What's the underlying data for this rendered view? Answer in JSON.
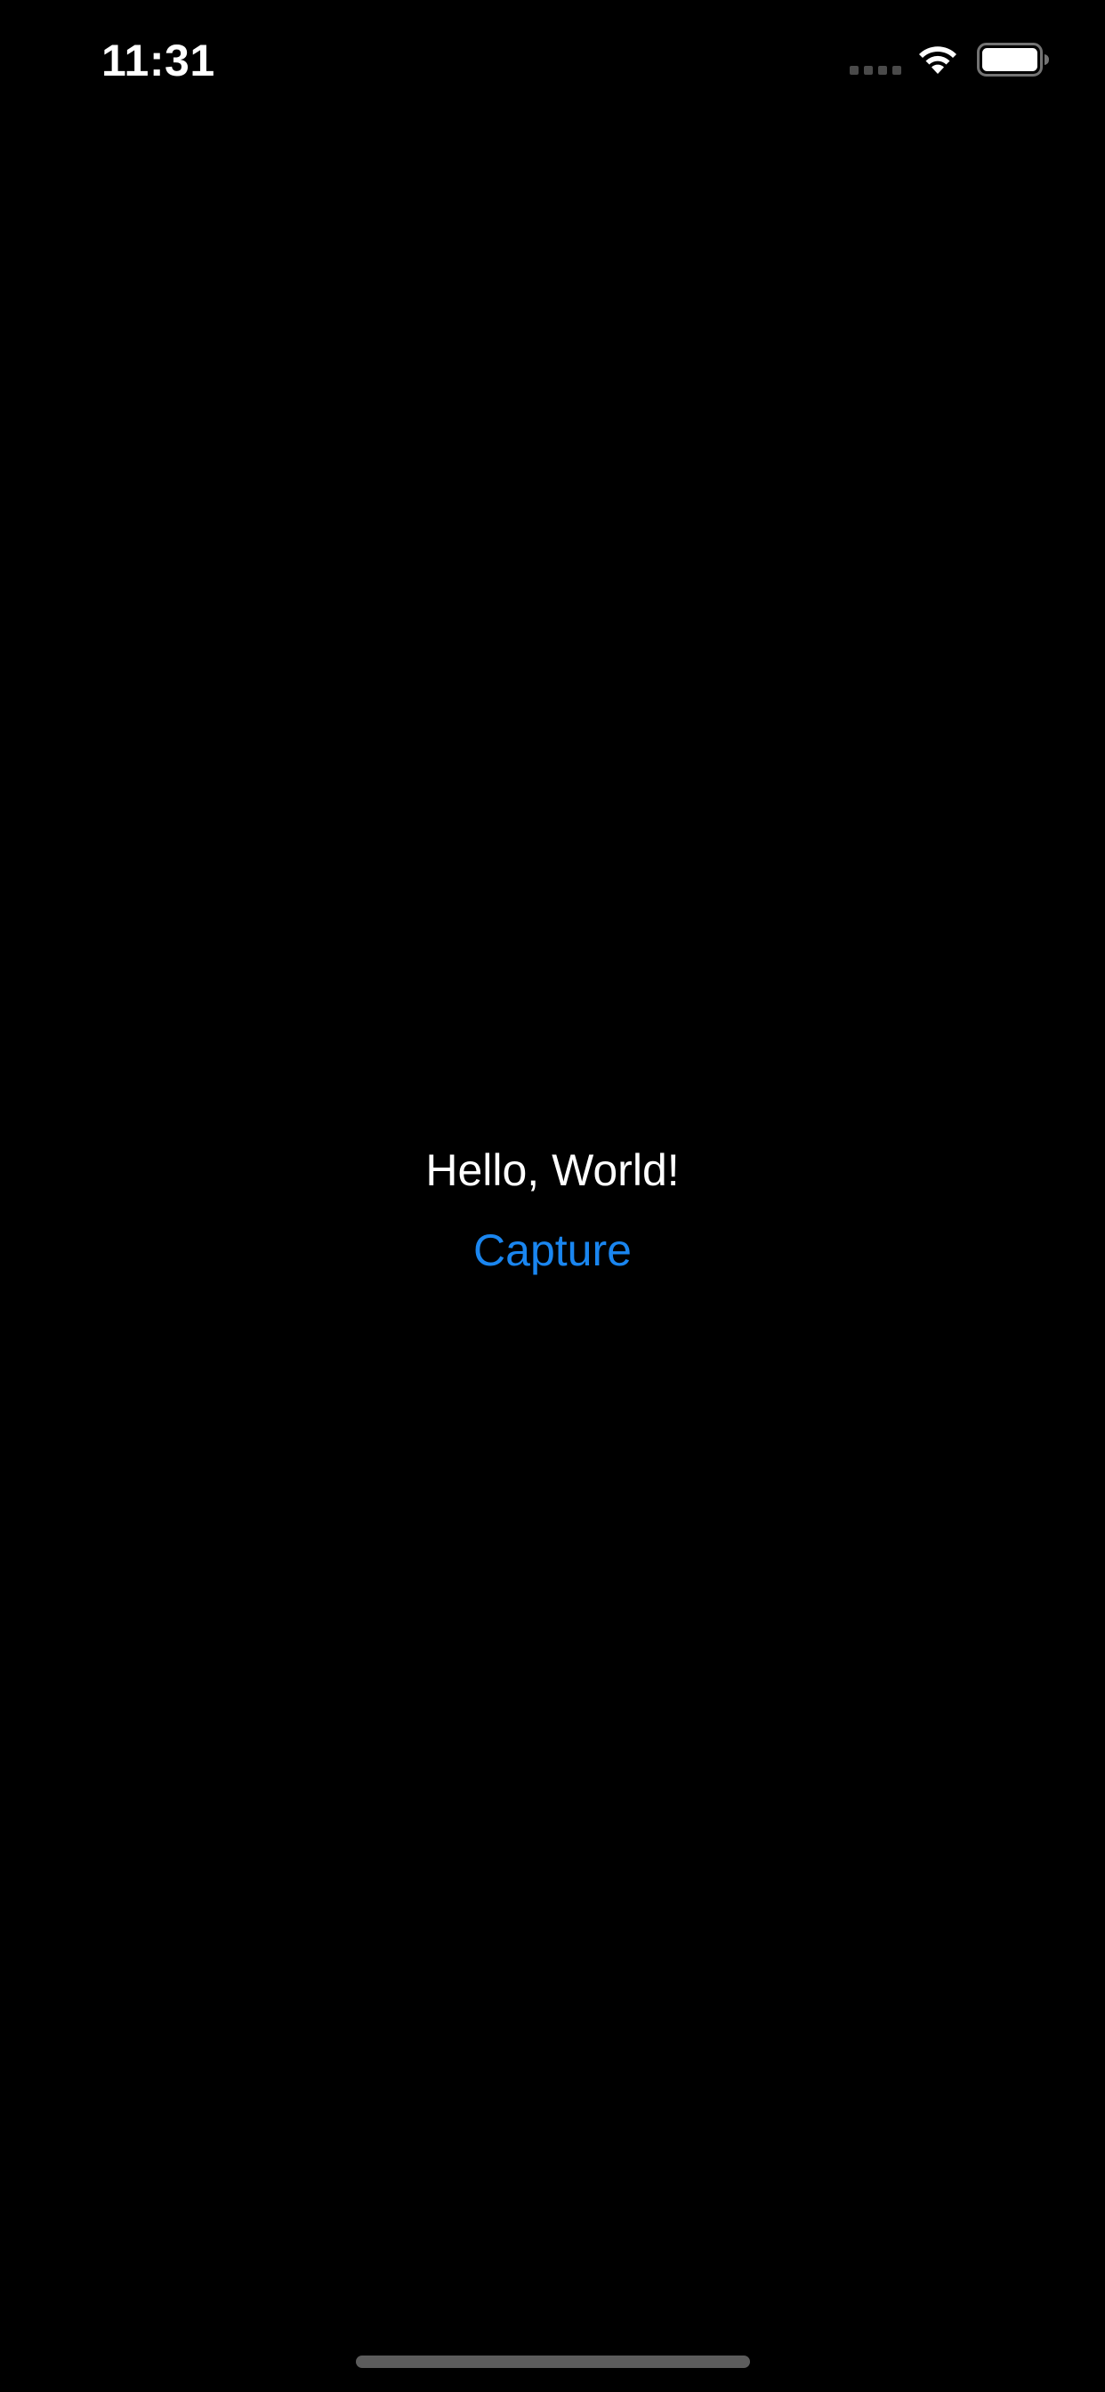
{
  "status_bar": {
    "time": "11:31",
    "signal_icon": "cellular-signal-icon",
    "wifi_icon": "wifi-icon",
    "battery_icon": "battery-full-icon"
  },
  "main": {
    "greeting": "Hello, World!",
    "capture_label": "Capture"
  },
  "colors": {
    "background": "#000000",
    "text": "#ffffff",
    "accent": "#1a86f0",
    "home_indicator": "#5c5c5c"
  }
}
